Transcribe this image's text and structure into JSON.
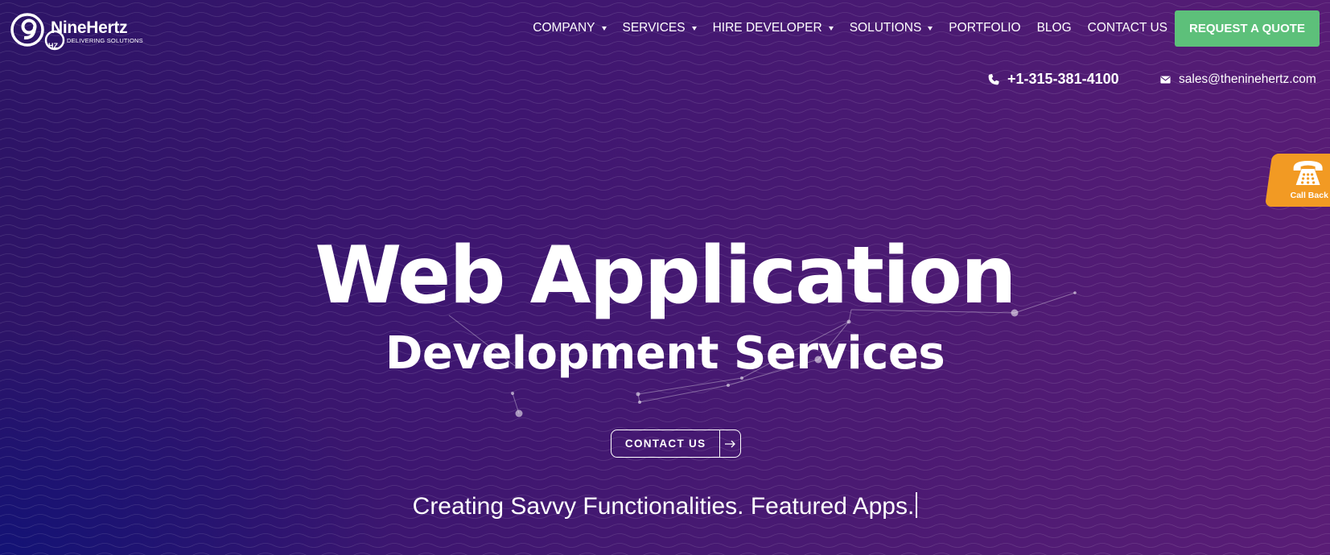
{
  "brand": {
    "name": "NineHertz",
    "tagline": "DELIVERING SOLUTIONS",
    "logo_mark_text": "HZ"
  },
  "nav": {
    "items": [
      {
        "label": "COMPANY",
        "has_dropdown": true
      },
      {
        "label": "SERVICES",
        "has_dropdown": true
      },
      {
        "label": "HIRE DEVELOPER",
        "has_dropdown": true
      },
      {
        "label": "SOLUTIONS",
        "has_dropdown": true
      },
      {
        "label": "PORTFOLIO",
        "has_dropdown": false
      },
      {
        "label": "BLOG",
        "has_dropdown": false
      },
      {
        "label": "CONTACT US",
        "has_dropdown": false
      }
    ],
    "cta_label": "REQUEST A QUOTE"
  },
  "contact": {
    "phone": "+1-315-381-4100",
    "email": "sales@theninehertz.com",
    "phone_icon": "phone-icon",
    "email_icon": "envelope-icon"
  },
  "callback": {
    "label": "Call Back",
    "icon": "telephone-icon"
  },
  "hero": {
    "title": "Web Application",
    "subtitle": "Development Services",
    "button_label": "CONTACT US",
    "button_icon": "arrow-right-icon",
    "tagline": "Creating Savvy Functionalities. Featured Apps."
  },
  "colors": {
    "background_start": "#2c1466",
    "background_end": "#5a1d76",
    "cta_green": "#5dc07a",
    "callback_orange": "#f29a23",
    "text": "#ffffff"
  }
}
